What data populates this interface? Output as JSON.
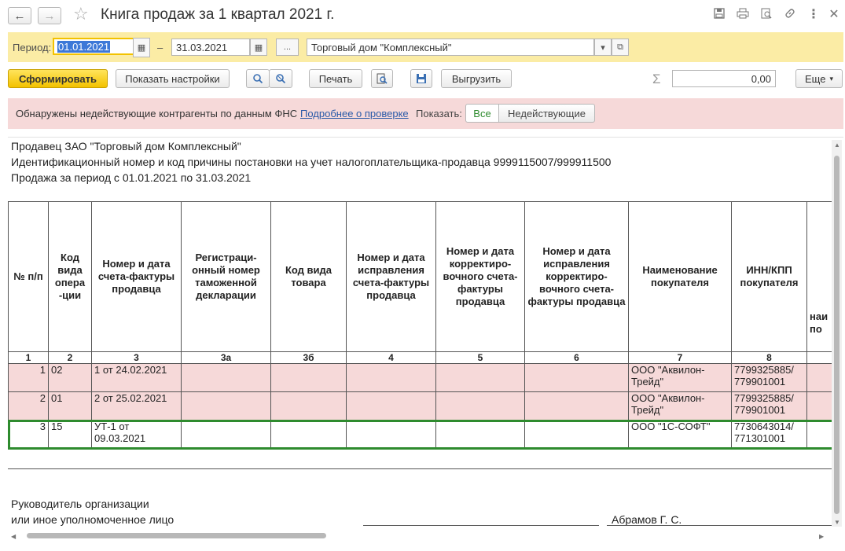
{
  "window": {
    "title": "Книга продаж за 1 квартал 2021 г."
  },
  "period_bar": {
    "label": "Период:",
    "date_from": "01.01.2021",
    "dash": "–",
    "date_to": "31.03.2021",
    "dots_button": "...",
    "organization": "Торговый дом \"Комплексный\""
  },
  "toolbar": {
    "generate": "Сформировать",
    "show_settings": "Показать настройки",
    "print": "Печать",
    "export": "Выгрузить",
    "sum_symbol": "Σ",
    "sum_value": "0,00",
    "more": "Еще"
  },
  "warning": {
    "text": "Обнаружены недействующие контрагенты по данным ФНС",
    "link": "Подробнее о проверке",
    "show_label": "Показать:",
    "filter_all": "Все",
    "filter_inactive": "Недействующие"
  },
  "report": {
    "seller_line": "Продавец  ЗАО \"Торговый дом Комплексный\"",
    "inn_line": "Идентификационный номер и код причины постановки на учет налогоплательщика-продавца  9999115007/999911500",
    "period_line": "Продажа за период с 01.01.2021 по 31.03.2021",
    "headers": [
      "№ п/п",
      "Код вида опера -ции",
      "Номер и дата счета-фактуры продавца",
      "Регистраци- онный номер таможенной декларации",
      "Код вида товара",
      "Номер и дата исправления счета-фактуры продавца",
      "Номер и дата корректиро- вочного счета-фактуры продавца",
      "Номер и дата исправления корректиро- вочного счета-фактуры продавца",
      "Наименование покупателя",
      "ИНН/КПП покупателя",
      "наи по"
    ],
    "column_numbers": [
      "1",
      "2",
      "3",
      "3а",
      "3б",
      "4",
      "5",
      "6",
      "7",
      "8",
      ""
    ],
    "rows": [
      {
        "n": "1",
        "op": "02",
        "invoice": "1 от 24.02.2021",
        "buyer": "ООО \"Аквилон-Трейд\"",
        "inn": "7799325885/ 779901001"
      },
      {
        "n": "2",
        "op": "01",
        "invoice": "2 от 25.02.2021",
        "buyer": "ООО \"Аквилон-Трейд\"",
        "inn": "7799325885/ 779901001"
      },
      {
        "n": "3",
        "op": "15",
        "invoice": "УТ-1 от 09.03.2021",
        "buyer": "ООО \"1С-СОФТ\"",
        "inn": "7730643014/ 771301001"
      }
    ],
    "signature": {
      "line1": "Руководитель организации",
      "line2": "или иное уполномоченное лицо",
      "name": "Абрамов Г. С."
    }
  },
  "colors": {
    "period_bar_bg": "#fbeca5",
    "warning_bg": "#f6d9d9",
    "generate_button": "#f3c200",
    "selected_row_border": "#2e8b2e",
    "link": "#2a5aa8"
  }
}
